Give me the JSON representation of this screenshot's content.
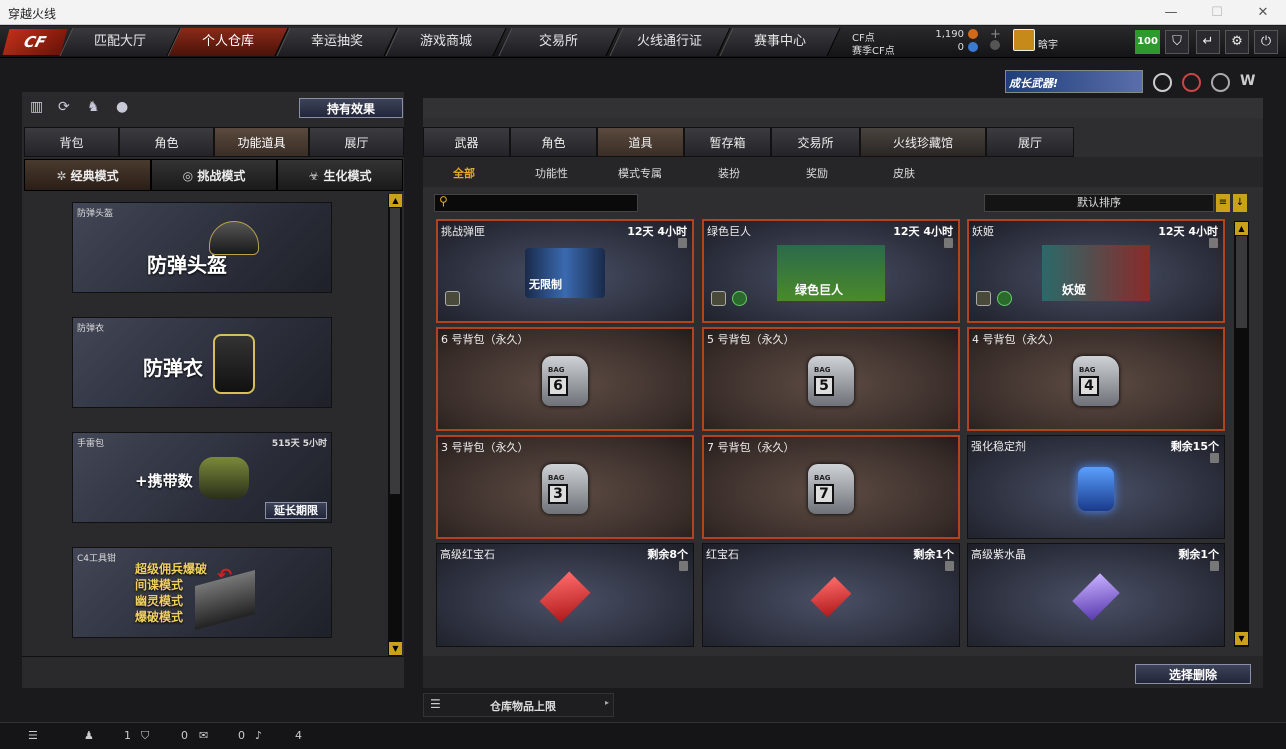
{
  "window": {
    "title": "穿越火线"
  },
  "nav": {
    "logo": "CF",
    "tabs": [
      "匹配大厅",
      "个人仓库",
      "幸运抽奖",
      "游戏商城",
      "交易所",
      "火线通行证",
      "赛事中心"
    ],
    "active": 1
  },
  "currency": {
    "cf_label": "CF点",
    "cf_value": "1,190",
    "match_label": "赛季CF点",
    "match_value": "0",
    "user": "晗宇",
    "level": "100"
  },
  "banner": {
    "text": "成长武器!"
  },
  "left": {
    "effect_button": "持有效果",
    "tabs": [
      "背包",
      "角色",
      "功能道具",
      "展厅"
    ],
    "modes": [
      "经典模式",
      "挑战模式",
      "生化模式"
    ],
    "cards": [
      {
        "name": "防弹头盔",
        "big": "防弹头盔"
      },
      {
        "name": "防弹衣",
        "big": "防弹衣"
      },
      {
        "name": "手雷包",
        "time": "515天 5小时",
        "big": "+携带数",
        "button": "延长期限"
      },
      {
        "name": "C4工具钳",
        "lines": [
          "超级佣兵爆破",
          "间谍模式",
          "幽灵模式",
          "爆破模式"
        ]
      }
    ]
  },
  "right": {
    "tabs": [
      "武器",
      "角色",
      "道具",
      "暂存箱",
      "交易所",
      "火线珍藏馆",
      "展厅"
    ],
    "filters": [
      "全部",
      "功能性",
      "模式专属",
      "装扮",
      "奖励",
      "皮肤"
    ],
    "sort_label": "默认排序",
    "search_placeholder": "",
    "items": [
      {
        "name": "挑战弹匣",
        "time": "12天 4小时",
        "img_text": "无限制"
      },
      {
        "name": "绿色巨人",
        "time": "12天 4小时",
        "img_text": "绿色巨人"
      },
      {
        "name": "妖姬",
        "time": "12天 4小时",
        "img_text": "妖姬"
      },
      {
        "name": "6 号背包（永久）",
        "bag": "6"
      },
      {
        "name": "5 号背包（永久）",
        "bag": "5"
      },
      {
        "name": "4 号背包（永久）",
        "bag": "4"
      },
      {
        "name": "3 号背包（永久）",
        "bag": "3"
      },
      {
        "name": "7 号背包（永久）",
        "bag": "7"
      },
      {
        "name": "强化稳定剂",
        "time": "剩余15个"
      },
      {
        "name": "高级红宝石",
        "time": "剩余8个"
      },
      {
        "name": "红宝石",
        "time": "剩余1个"
      },
      {
        "name": "高级紫水晶",
        "time": "剩余1个"
      }
    ],
    "delete_button": "选择删除",
    "storage_label": "仓库物品上限"
  },
  "status": {
    "friends": "1",
    "shield": "0",
    "chat": "0",
    "volume": "4"
  },
  "colors": {
    "accent": "#e2a826",
    "active_tab": "#8a2a1a",
    "rare_border": "#b2431e"
  }
}
